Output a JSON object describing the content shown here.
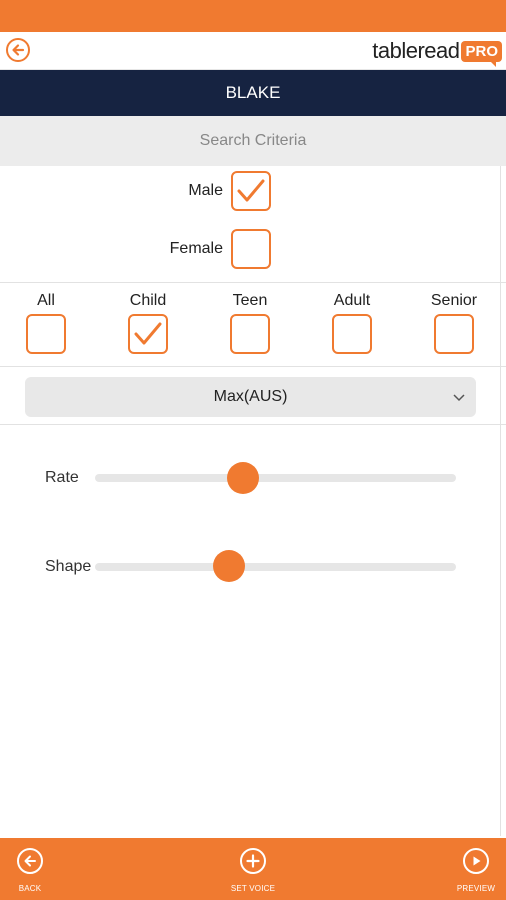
{
  "app": {
    "logo_text": "tableread",
    "logo_badge": "PRO"
  },
  "character": {
    "name": "BLAKE"
  },
  "criteria": {
    "title": "Search Criteria"
  },
  "gender": [
    {
      "label": "Male",
      "checked": true
    },
    {
      "label": "Female",
      "checked": false
    }
  ],
  "age_groups": [
    {
      "label": "All",
      "checked": false
    },
    {
      "label": "Child",
      "checked": true
    },
    {
      "label": "Teen",
      "checked": false
    },
    {
      "label": "Adult",
      "checked": false
    },
    {
      "label": "Senior",
      "checked": false
    }
  ],
  "voice_select": {
    "value": "Max(AUS)"
  },
  "sliders": {
    "rate": {
      "label": "Rate",
      "value": 0.41
    },
    "shape": {
      "label": "Shape",
      "value": 0.37
    }
  },
  "bottom_nav": {
    "back": "BACK",
    "set_voice": "SET VOICE",
    "preview": "PREVIEW"
  },
  "colors": {
    "accent": "#f07a30",
    "title_bar": "#162341"
  }
}
